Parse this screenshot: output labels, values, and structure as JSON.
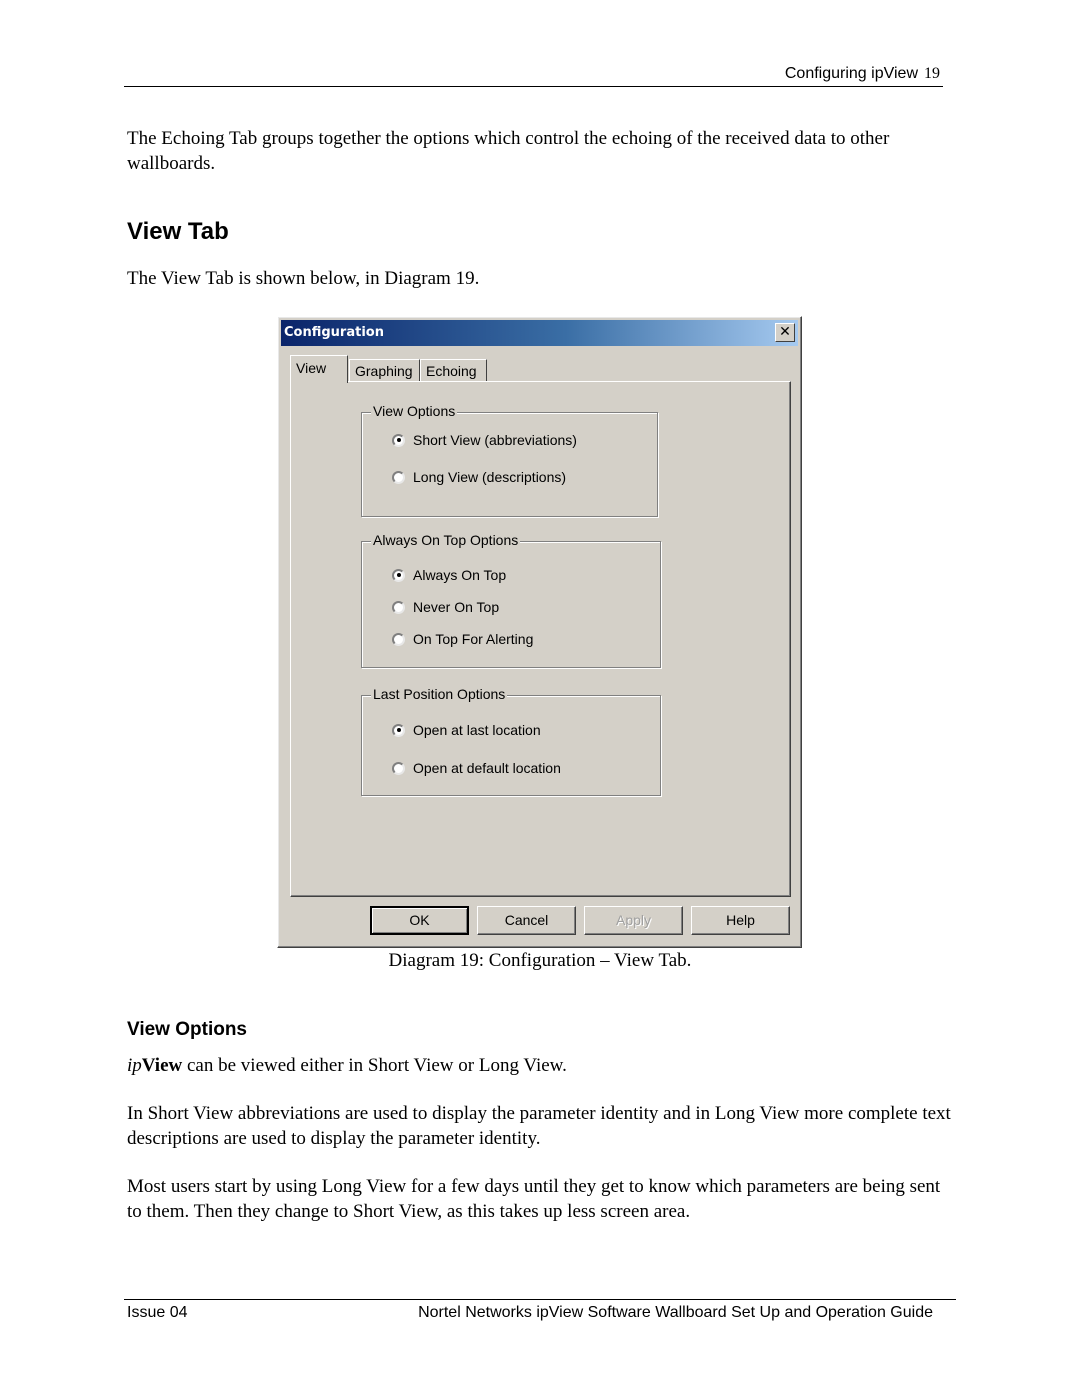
{
  "header": {
    "section": "Configuring ipView",
    "page_number": "19"
  },
  "intro_paragraph": "The Echoing Tab groups together the options which control the echoing of the received data to other wallboards.",
  "section_heading": "View Tab",
  "section_intro": "The View Tab is shown below, in Diagram 19.",
  "dialog": {
    "title": "Configuration",
    "close_icon": "close-x-icon",
    "tabs": [
      {
        "label": "View",
        "active": true
      },
      {
        "label": "Graphing",
        "active": false
      },
      {
        "label": "Echoing",
        "active": false
      }
    ],
    "groups": [
      {
        "label": "View Options",
        "options": [
          {
            "label": "Short View (abbreviations)",
            "selected": true
          },
          {
            "label": "Long View (descriptions)",
            "selected": false
          }
        ]
      },
      {
        "label": "Always On Top Options",
        "options": [
          {
            "label": "Always On Top",
            "selected": true
          },
          {
            "label": "Never On Top",
            "selected": false
          },
          {
            "label": "On Top For Alerting",
            "selected": false
          }
        ]
      },
      {
        "label": "Last Position Options",
        "options": [
          {
            "label": "Open at last location",
            "selected": true
          },
          {
            "label": "Open at default location",
            "selected": false
          }
        ]
      }
    ],
    "buttons": {
      "ok": "OK",
      "cancel": "Cancel",
      "apply": "Apply",
      "help": "Help"
    }
  },
  "caption": "Diagram 19: Configuration – View Tab.",
  "subheading": "View Options",
  "view_options_para1": {
    "italic": "ip",
    "bold": "View",
    "rest": " can be viewed either in Short View or Long View."
  },
  "view_options_para2": "In Short View abbreviations are used to display the parameter identity and in Long View more complete text descriptions are used to display the parameter identity.",
  "view_options_para3": "Most users start by using Long View for a few days until they get to know which parameters are being sent to them.  Then they change to Short View, as this takes up less screen area.",
  "footer": {
    "left": "Issue 04",
    "right": "Nortel Networks ipView Software Wallboard Set Up and Operation Guide"
  }
}
